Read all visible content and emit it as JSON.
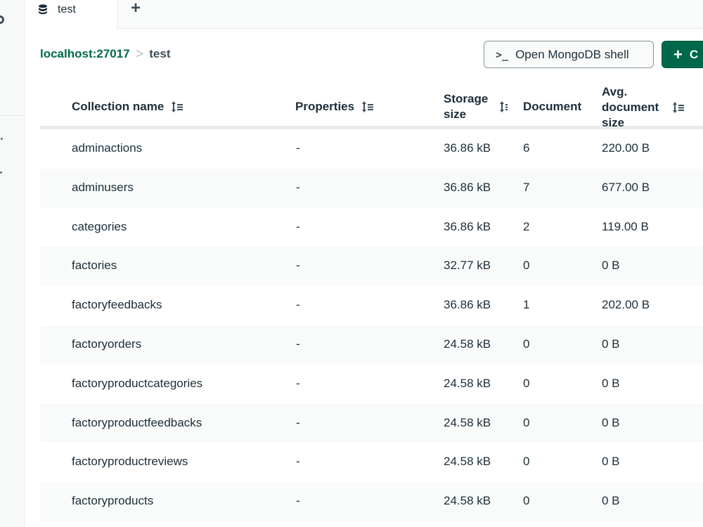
{
  "tabs": [
    {
      "label": "test",
      "icon": "database-icon"
    }
  ],
  "add_tab_icon": "plus-icon",
  "breadcrumb": {
    "host": "localhost:27017",
    "separator": ">",
    "database": "test"
  },
  "toolbar": {
    "shell_icon": ">_",
    "shell_label": "Open MongoDB shell",
    "create_icon": "+",
    "create_label": "C"
  },
  "colors": {
    "accent": "#00684a",
    "text": "#1c2d38",
    "row_alt": "#f9fbfa"
  },
  "table": {
    "headers": {
      "name": "Collection name",
      "properties": "Properties",
      "storage": "Storage size",
      "documents": "Document",
      "avg": "Avg. document size"
    },
    "rows": [
      {
        "name": "adminactions",
        "properties": "-",
        "storage": "36.86 kB",
        "documents": "6",
        "avg": "220.00 B"
      },
      {
        "name": "adminusers",
        "properties": "-",
        "storage": "36.86 kB",
        "documents": "7",
        "avg": "677.00 B"
      },
      {
        "name": "categories",
        "properties": "-",
        "storage": "36.86 kB",
        "documents": "2",
        "avg": "119.00 B"
      },
      {
        "name": "factories",
        "properties": "-",
        "storage": "32.77 kB",
        "documents": "0",
        "avg": "0 B"
      },
      {
        "name": "factoryfeedbacks",
        "properties": "-",
        "storage": "36.86 kB",
        "documents": "1",
        "avg": "202.00 B"
      },
      {
        "name": "factoryorders",
        "properties": "-",
        "storage": "24.58 kB",
        "documents": "0",
        "avg": "0 B"
      },
      {
        "name": "factoryproductcategories",
        "properties": "-",
        "storage": "24.58 kB",
        "documents": "0",
        "avg": "0 B"
      },
      {
        "name": "factoryproductfeedbacks",
        "properties": "-",
        "storage": "24.58 kB",
        "documents": "0",
        "avg": "0 B"
      },
      {
        "name": "factoryproductreviews",
        "properties": "-",
        "storage": "24.58 kB",
        "documents": "0",
        "avg": "0 B"
      },
      {
        "name": "factoryproducts",
        "properties": "-",
        "storage": "24.58 kB",
        "documents": "0",
        "avg": "0 B"
      }
    ]
  }
}
